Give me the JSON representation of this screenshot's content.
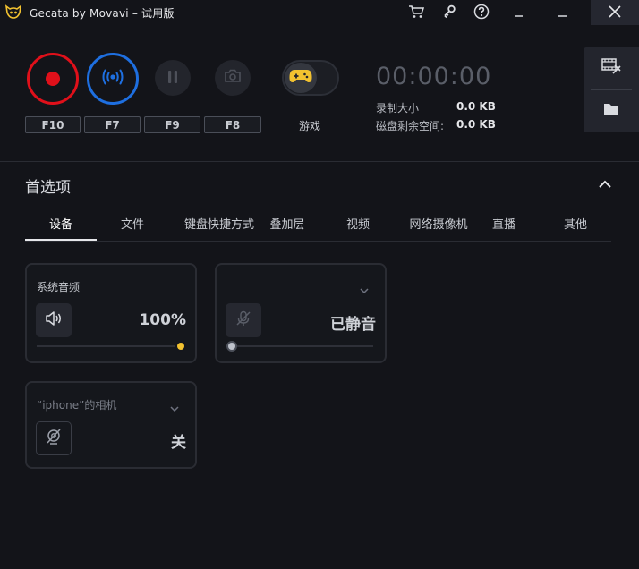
{
  "titlebar": {
    "app_title": "Gecata by Movavi – 试用版",
    "icons": [
      "logo-icon",
      "cart-icon",
      "key-icon",
      "help-icon",
      "minimize-icon",
      "maximize-icon",
      "close-icon"
    ]
  },
  "controls": {
    "record_hotkey": "F10",
    "stream_hotkey": "F7",
    "pause_hotkey": "F9",
    "screenshot_hotkey": "F8",
    "game_mode_label": "游戏"
  },
  "status": {
    "timer": "00:00:00",
    "record_size_label": "录制大小",
    "record_size_value": "0.0 KB",
    "disk_space_label": "磁盘剩余空间:",
    "disk_space_value": "0.0 KB"
  },
  "preferences": {
    "title": "首选项",
    "tabs": [
      {
        "label": "设备",
        "active": true
      },
      {
        "label": "文件"
      },
      {
        "label": "键盘快捷方式"
      },
      {
        "label": "叠加层"
      },
      {
        "label": "视频"
      },
      {
        "label": "网络摄像机"
      },
      {
        "label": "直播"
      },
      {
        "label": "其他"
      }
    ],
    "devices": {
      "system_audio": {
        "title": "系统音频",
        "value": "100%",
        "level": 1.0
      },
      "microphone": {
        "title": "",
        "value": "已静音",
        "level": 0.0
      },
      "camera": {
        "title": "“iphone”的相机",
        "value": "关"
      }
    }
  },
  "colors": {
    "record": "#e0101a",
    "stream": "#1e6fe0",
    "accent_yellow": "#f2c230",
    "background": "#131419"
  }
}
